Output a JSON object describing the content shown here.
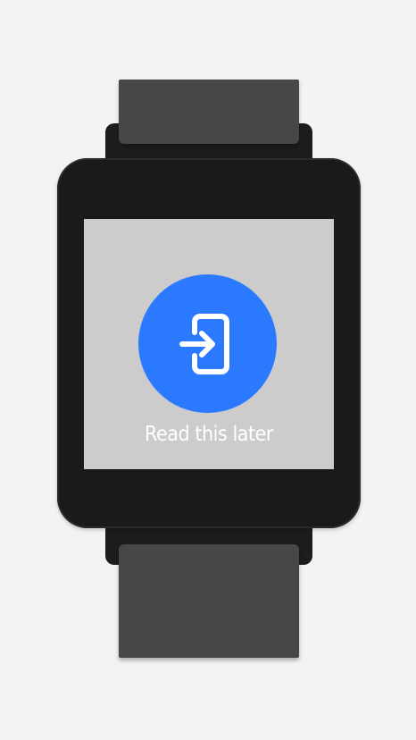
{
  "device": {
    "type": "smartwatch",
    "band_color": "#474747",
    "body_color": "#1a1a1a",
    "screen_color": "#cccccc"
  },
  "screen": {
    "action": {
      "icon": "sign-in-icon",
      "button_color": "#2a79ff",
      "label": "Read this later"
    }
  }
}
